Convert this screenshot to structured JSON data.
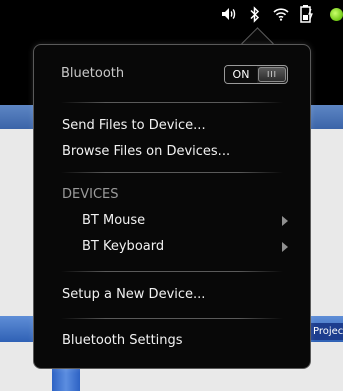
{
  "popup": {
    "title": "Bluetooth",
    "switch_on_label": "ON",
    "switch_knob_label": "III",
    "actions": [
      "Send Files to Device...",
      "Browse Files on Devices..."
    ],
    "devices_header": "DEVICES",
    "devices": [
      "BT Mouse",
      "BT Keyboard"
    ],
    "setup_label": "Setup a New Device...",
    "settings_label": "Bluetooth Settings"
  },
  "background": {
    "project_tab": "Project"
  },
  "icons": {
    "volume": "volume-icon",
    "bluetooth": "bluetooth-icon",
    "wifi": "wifi-icon",
    "battery": "battery-charging-icon",
    "status_light": "status-dot-icon"
  },
  "colors": {
    "popup_bg": "#080808",
    "status_dot": "#6fc615",
    "taskbar_blue": "#2f61b5"
  }
}
